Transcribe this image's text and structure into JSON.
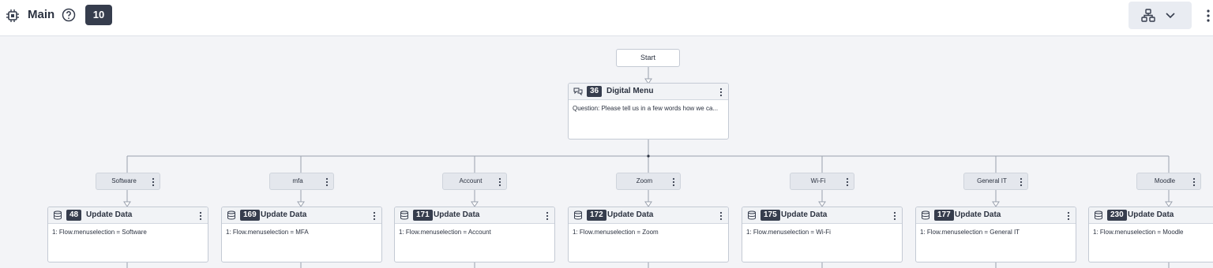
{
  "header": {
    "title": "Main",
    "count": "10"
  },
  "flow": {
    "start_label": "Start",
    "menu_node": {
      "id": "36",
      "title": "Digital Menu",
      "body": "Question: Please tell us in a few words how we ca...",
      "icon": "chat-bubbles-icon"
    },
    "branches": [
      {
        "label": "Software",
        "node_id": "48",
        "node_title": "Update Data",
        "body": "1: Flow.menuselection = Software"
      },
      {
        "label": "mfa",
        "node_id": "169",
        "node_title": "Update Data",
        "body": "1: Flow.menuselection = MFA"
      },
      {
        "label": "Account",
        "node_id": "171",
        "node_title": "Update Data",
        "body": "1: Flow.menuselection = Account"
      },
      {
        "label": "Zoom",
        "node_id": "172",
        "node_title": "Update Data",
        "body": "1: Flow.menuselection = Zoom"
      },
      {
        "label": "Wi-Fi",
        "node_id": "175",
        "node_title": "Update Data",
        "body": "1: Flow.menuselection = Wi-Fi"
      },
      {
        "label": "General IT",
        "node_id": "177",
        "node_title": "Update Data",
        "body": "1: Flow.menuselection = General IT"
      },
      {
        "label": "Moodle",
        "node_id": "230",
        "node_title": "Update Data",
        "body": "1: Flow.menuselection = Moodle"
      }
    ]
  },
  "colors": {
    "badge": "#363d4d",
    "wire": "#9aa1ad",
    "canvas": "#f3f4f7"
  }
}
